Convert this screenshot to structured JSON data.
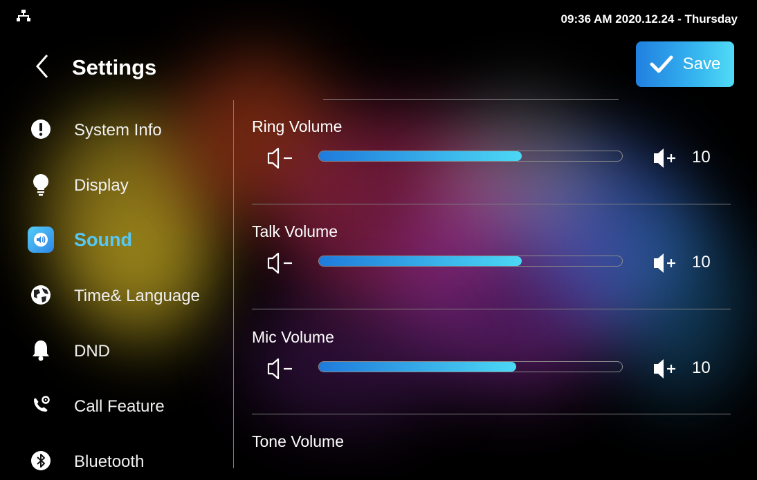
{
  "status_bar": {
    "network_icon": "network-icon",
    "datetime": "09:36 AM  2020.12.24 - Thursday"
  },
  "header": {
    "title": "Settings",
    "save_label": "Save",
    "back_icon": "chevron-left-icon",
    "save_icon": "checkmark-icon"
  },
  "sidebar": {
    "items": [
      {
        "label": "System Info",
        "icon": "info-icon",
        "active": false
      },
      {
        "label": "Display",
        "icon": "lightbulb-icon",
        "active": false
      },
      {
        "label": "Sound",
        "icon": "speaker-icon",
        "active": true
      },
      {
        "label": "Time& Language",
        "icon": "globe-icon",
        "active": false
      },
      {
        "label": "DND",
        "icon": "bell-icon",
        "active": false
      },
      {
        "label": "Call Feature",
        "icon": "phone-gear-icon",
        "active": false
      },
      {
        "label": "Bluetooth",
        "icon": "bluetooth-icon",
        "active": false
      }
    ]
  },
  "volumes": [
    {
      "label": "Ring Volume",
      "value": "10",
      "level": 0.67
    },
    {
      "label": "Talk Volume",
      "value": "10",
      "level": 0.67
    },
    {
      "label": "Mic Volume",
      "value": "10",
      "level": 0.65
    },
    {
      "label": "Tone Volume"
    }
  ],
  "colors": {
    "accent": "#2f86e8",
    "accent_light": "#56c8f4",
    "background": "#000000"
  }
}
